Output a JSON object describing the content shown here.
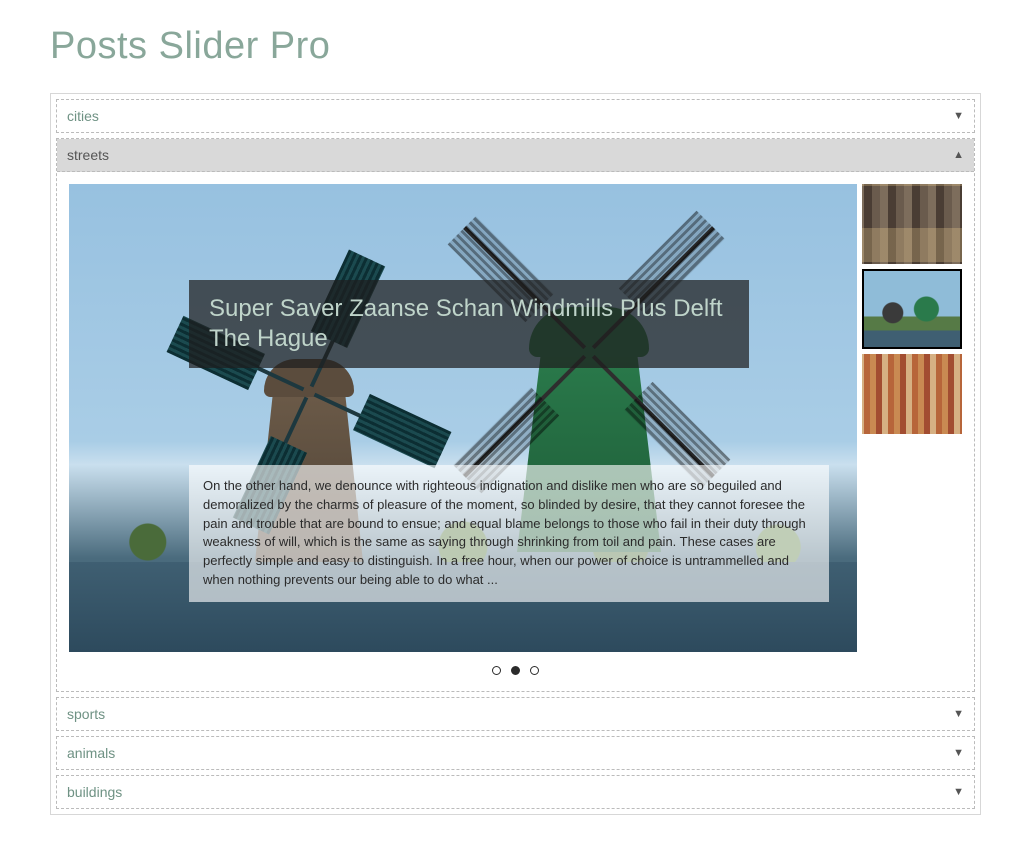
{
  "page": {
    "title": "Posts Slider Pro"
  },
  "accordion": {
    "items": [
      {
        "label": "cities",
        "open": false
      },
      {
        "label": "streets",
        "open": true
      },
      {
        "label": "sports",
        "open": false
      },
      {
        "label": "animals",
        "open": false
      },
      {
        "label": "buildings",
        "open": false
      }
    ]
  },
  "slide": {
    "title": "Super Saver Zaanse Schan Windmills Plus Delft The Hague",
    "body": "On the other hand, we denounce with righteous indignation and dislike men who are so beguiled and demoralized by the charms of pleasure of the moment, so blinded by desire, that they cannot foresee the pain and trouble that are bound to ensue; and equal blame belongs to those who fail in their duty through weakness of will, which is the same as saying through shrinking from toil and pain. These cases are perfectly simple and easy to distinguish. In a free hour, when our power of choice is untrammelled and when nothing prevents our being able to do what ..."
  },
  "thumbs": {
    "count": 3,
    "active_index": 1,
    "names": [
      "canal-houses",
      "windmills",
      "rooftops"
    ]
  },
  "pager": {
    "count": 3,
    "active_index": 1
  },
  "icons": {
    "collapsed": "▼",
    "expanded": "▲"
  }
}
